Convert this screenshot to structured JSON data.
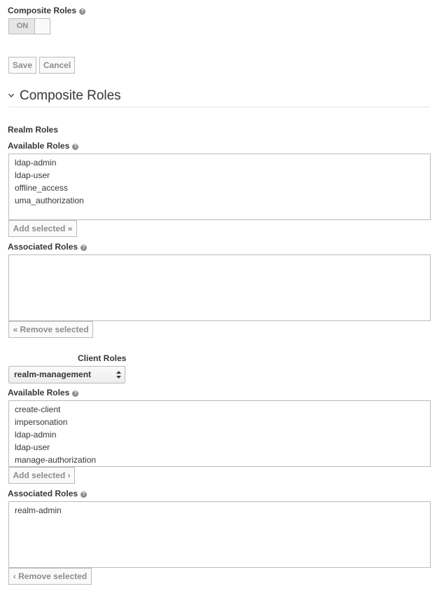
{
  "composite_roles": {
    "label": "Composite Roles",
    "toggle_state": "ON"
  },
  "actions": {
    "save_label": "Save",
    "cancel_label": "Cancel"
  },
  "section": {
    "title": "Composite Roles"
  },
  "realm_roles": {
    "heading": "Realm Roles",
    "available_label": "Available Roles",
    "available": [
      "ldap-admin",
      "ldap-user",
      "offline_access",
      "uma_authorization"
    ],
    "add_label": "Add selected »",
    "associated_label": "Associated Roles",
    "associated": [],
    "remove_label": "« Remove selected"
  },
  "client_roles": {
    "heading": "Client Roles",
    "selected_client": "realm-management",
    "available_label": "Available Roles",
    "available": [
      "create-client",
      "impersonation",
      "ldap-admin",
      "ldap-user",
      "manage-authorization"
    ],
    "add_label": "Add selected ›",
    "associated_label": "Associated Roles",
    "associated": [
      "realm-admin"
    ],
    "remove_label": "‹ Remove selected"
  },
  "icons": {
    "help": "question-circle-icon",
    "section_toggle": "chevron-down-icon",
    "select_arrows": "sort-arrows-icon"
  }
}
